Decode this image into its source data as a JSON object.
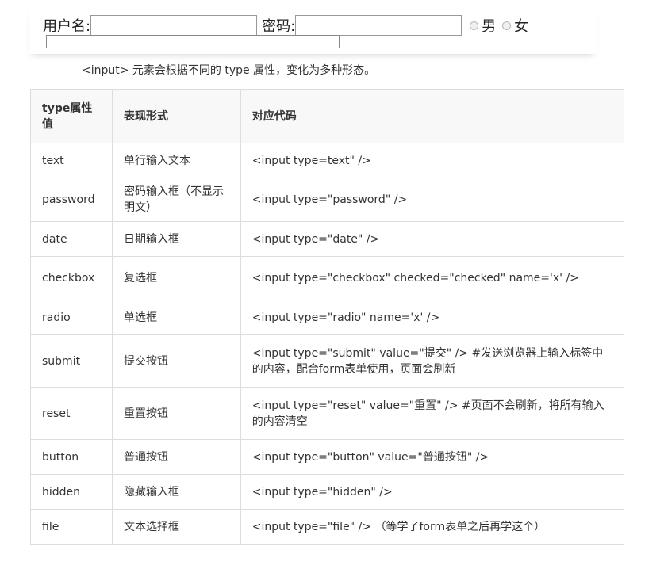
{
  "form": {
    "username_label": "用户名:",
    "password_label": "密码:",
    "gender_options": [
      "男",
      "女"
    ]
  },
  "intro_text": "<input> 元素会根据不同的 type 属性，变化为多种形态。",
  "table": {
    "headers": [
      "type属性值",
      "表现形式",
      "对应代码"
    ],
    "rows": [
      {
        "type": "text",
        "form": "单行输入文本",
        "code": "<input type=text\" />"
      },
      {
        "type": "password",
        "form": "密码输入框（不显示明文）",
        "code": "<input type=\"password\"  />"
      },
      {
        "type": "date",
        "form": "日期输入框",
        "code": "<input type=\"date\" />"
      },
      {
        "type": "checkbox",
        "form": "复选框",
        "code": "<input type=\"checkbox\" checked=\"checked\" name='x' />"
      },
      {
        "type": "radio",
        "form": "单选框",
        "code": "<input type=\"radio\" name='x' />"
      },
      {
        "type": "submit",
        "form": "提交按钮",
        "code": "<input type=\"submit\" value=\"提交\" /> #发送浏览器上输入标签中的内容，配合form表单使用，页面会刷新"
      },
      {
        "type": "reset",
        "form": "重置按钮",
        "code": "<input type=\"reset\" value=\"重置\"  />  #页面不会刷新，将所有输入的内容清空"
      },
      {
        "type": "button",
        "form": "普通按钮",
        "code": "<input type=\"button\" value=\"普通按钮\"  />"
      },
      {
        "type": "hidden",
        "form": "隐藏输入框",
        "code": "<input type=\"hidden\"  />"
      },
      {
        "type": "file",
        "form": "文本选择框",
        "code": "<input type=\"file\"  />  （等学了form表单之后再学这个）"
      }
    ]
  }
}
